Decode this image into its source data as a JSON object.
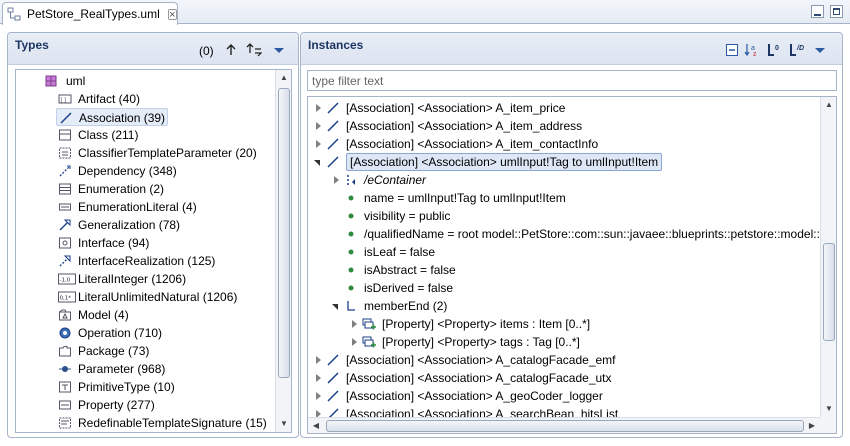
{
  "editor": {
    "tab_title": "PetStore_RealTypes.uml",
    "close_glyph": "⊠"
  },
  "types_pane": {
    "title": "Types",
    "count": "(0)",
    "root": {
      "label": "uml",
      "icon": "package-icon"
    },
    "items": [
      {
        "label": "Artifact (40)",
        "icon": "artifact-icon"
      },
      {
        "label": "Association (39)",
        "icon": "association-icon",
        "selected": true
      },
      {
        "label": "Class (211)",
        "icon": "class-icon"
      },
      {
        "label": "ClassifierTemplateParameter (20)",
        "icon": "classifier-template-parameter-icon"
      },
      {
        "label": "Dependency (348)",
        "icon": "dependency-icon"
      },
      {
        "label": "Enumeration (2)",
        "icon": "enumeration-icon"
      },
      {
        "label": "EnumerationLiteral (4)",
        "icon": "enumeration-literal-icon"
      },
      {
        "label": "Generalization (78)",
        "icon": "generalization-icon"
      },
      {
        "label": "Interface (94)",
        "icon": "interface-icon"
      },
      {
        "label": "InterfaceRealization (125)",
        "icon": "interface-realization-icon"
      },
      {
        "label": "LiteralInteger (1206)",
        "icon": "literal-integer-icon",
        "glyph": "-1,0"
      },
      {
        "label": "LiteralUnlimitedNatural (1206)",
        "icon": "literal-unlimited-natural-icon",
        "glyph": "0,1*"
      },
      {
        "label": "Model (4)",
        "icon": "model-icon"
      },
      {
        "label": "Operation (710)",
        "icon": "operation-icon"
      },
      {
        "label": "Package (73)",
        "icon": "package-folder-icon"
      },
      {
        "label": "Parameter (968)",
        "icon": "parameter-icon"
      },
      {
        "label": "PrimitiveType (10)",
        "icon": "primitive-type-icon"
      },
      {
        "label": "Property (277)",
        "icon": "property-icon"
      },
      {
        "label": "RedefinableTemplateSignature (15)",
        "icon": "redefinable-template-signature-icon"
      }
    ]
  },
  "instances_pane": {
    "title": "Instances",
    "filter_placeholder": "type filter text",
    "toolbar_badges": {
      "sort": "a↓z",
      "level0": "0",
      "levelD": "D"
    },
    "rows": [
      {
        "depth": 0,
        "expander": "closed",
        "icon": "association-icon",
        "label": "[Association] <Association> A_item_price"
      },
      {
        "depth": 0,
        "expander": "closed",
        "icon": "association-icon",
        "label": "[Association] <Association> A_item_address"
      },
      {
        "depth": 0,
        "expander": "closed",
        "icon": "association-icon",
        "label": "[Association] <Association> A_item_contactInfo"
      },
      {
        "depth": 0,
        "expander": "open",
        "icon": "association-icon",
        "label": "[Association] <Association> umlInput!Tag to umlInput!Item",
        "selected": true
      },
      {
        "depth": 1,
        "expander": "closed",
        "icon": "econtainer-icon",
        "label": "/eContainer",
        "italic": true
      },
      {
        "depth": 1,
        "expander": "none",
        "icon": "attribute-dot-icon",
        "label": "name = umlInput!Tag to umlInput!Item"
      },
      {
        "depth": 1,
        "expander": "none",
        "icon": "attribute-dot-icon",
        "label": "visibility = public"
      },
      {
        "depth": 1,
        "expander": "none",
        "icon": "attribute-dot-icon",
        "label": "/qualifiedName = root model::PetStore::com::sun::javaee::blueprints::petstore::model::umlInput!Tag to umlInput!Item"
      },
      {
        "depth": 1,
        "expander": "none",
        "icon": "attribute-dot-icon",
        "label": "isLeaf = false"
      },
      {
        "depth": 1,
        "expander": "none",
        "icon": "attribute-dot-icon",
        "label": "isAbstract = false"
      },
      {
        "depth": 1,
        "expander": "none",
        "icon": "attribute-dot-icon",
        "label": "isDerived = false"
      },
      {
        "depth": 1,
        "expander": "open",
        "icon": "reference-list-icon",
        "label": "memberEnd (2)"
      },
      {
        "depth": 2,
        "expander": "closed",
        "icon": "property-plus-icon",
        "label": "[Property] <Property> items : Item [0..*]"
      },
      {
        "depth": 2,
        "expander": "closed",
        "icon": "property-plus-icon",
        "label": "[Property] <Property> tags : Tag [0..*]"
      },
      {
        "depth": 0,
        "expander": "closed",
        "icon": "association-icon",
        "label": "[Association] <Association> A_catalogFacade_emf"
      },
      {
        "depth": 0,
        "expander": "closed",
        "icon": "association-icon",
        "label": "[Association] <Association> A_catalogFacade_utx"
      },
      {
        "depth": 0,
        "expander": "closed",
        "icon": "association-icon",
        "label": "[Association] <Association> A_geoCoder_logger"
      },
      {
        "depth": 0,
        "expander": "closed",
        "icon": "association-icon",
        "label": "[Association] <Association> A_searchBean_hitsList"
      }
    ]
  },
  "colors": {
    "accent": "#1c3563",
    "border": "#a6b4c9",
    "selection": "#dde7f6",
    "attribute_green": "#2e8b3e"
  }
}
